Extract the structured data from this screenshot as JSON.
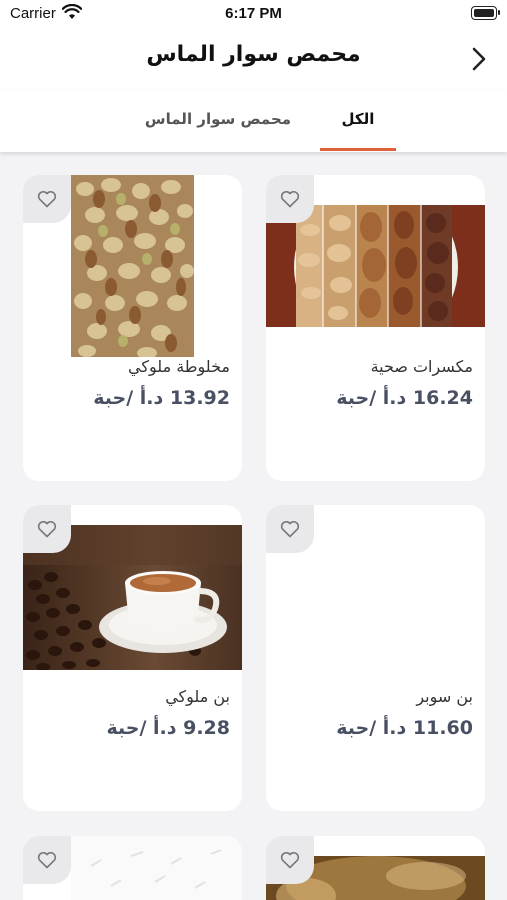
{
  "status": {
    "carrier": "Carrier",
    "time": "6:17 PM"
  },
  "nav": {
    "title": "محمص سوار الماس"
  },
  "tabs": [
    {
      "label": "الكل",
      "active": true
    },
    {
      "label": "محمص سوار الماس",
      "active": false
    }
  ],
  "colors": {
    "accent": "#e0603a",
    "price": "#4a5063"
  },
  "products": [
    {
      "name": "مكسرات صحية",
      "price": "16.24 د.أ /حبة",
      "image": "healthy-nuts-image"
    },
    {
      "name": "مخلوطة ملوكي",
      "price": "13.92 د.أ /حبة",
      "image": "mixed-nuts-image"
    },
    {
      "name": "بن سوبر",
      "price": "11.60 د.أ /حبة",
      "image": ""
    },
    {
      "name": "بن ملوكي",
      "price": "9.28 د.أ /حبة",
      "image": "coffee-cup-image"
    }
  ]
}
